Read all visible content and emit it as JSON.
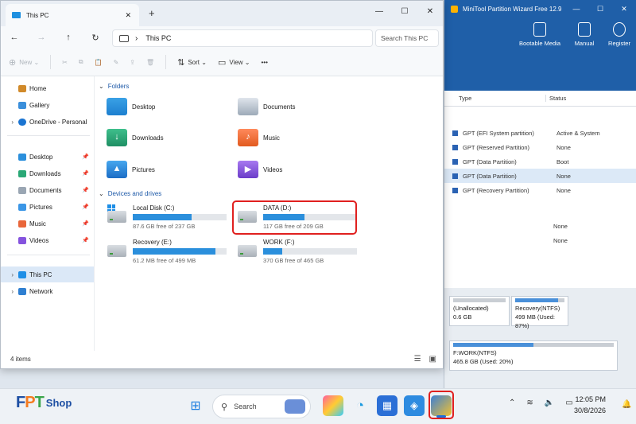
{
  "minitool": {
    "title": "MiniTool Partition Wizard Free 12.9",
    "title_controls": [
      "—",
      "☐",
      "✕"
    ],
    "tools": [
      {
        "label": "Bootable Media",
        "icon": "usb-icon"
      },
      {
        "label": "Manual",
        "icon": "book-icon"
      },
      {
        "label": "Register",
        "icon": "user-icon"
      }
    ],
    "columns": [
      "Type",
      "Status"
    ],
    "rows": [
      {
        "type": "GPT (EFI System partition)",
        "status": "Active & System"
      },
      {
        "type": "GPT (Reserved Partition)",
        "status": "None"
      },
      {
        "type": "GPT (Data Partition)",
        "status": "Boot"
      },
      {
        "type": "GPT (Data Partition)",
        "status": "None"
      },
      {
        "type": "GPT (Recovery Partition)",
        "status": "None"
      },
      {
        "type": "",
        "status": "None"
      },
      {
        "type": "",
        "status": "None"
      }
    ],
    "disk_parts": [
      {
        "name": "(Unallocated)",
        "size": "0.6 GB"
      },
      {
        "name": "Recovery(NTFS)",
        "size": "499 MB (Used: 87%)"
      },
      {
        "name": "F:WORK(NTFS)",
        "size": "465.8 GB (Used: 20%)"
      }
    ]
  },
  "explorer": {
    "tab_title": "This PC",
    "tab_close": "✕",
    "new_tab": "+",
    "window_controls": [
      "—",
      "☐",
      "✕"
    ],
    "nav": {
      "back": "←",
      "forward": "→",
      "up": "↑",
      "refresh": "↻"
    },
    "address": "This PC",
    "address_chevron": "›",
    "search_placeholder": "Search This PC",
    "commands": {
      "new": "New",
      "sort": "Sort",
      "view": "View",
      "more": "•••"
    },
    "sidebar": [
      {
        "label": "Home",
        "pinned": false
      },
      {
        "label": "Gallery",
        "pinned": false
      },
      {
        "label": "OneDrive - Personal",
        "pinned": false
      },
      {
        "label": "Desktop",
        "pinned": true
      },
      {
        "label": "Downloads",
        "pinned": true
      },
      {
        "label": "Documents",
        "pinned": true
      },
      {
        "label": "Pictures",
        "pinned": true
      },
      {
        "label": "Music",
        "pinned": true
      },
      {
        "label": "Videos",
        "pinned": true
      },
      {
        "label": "This PC",
        "pinned": false
      },
      {
        "label": "Network",
        "pinned": false
      }
    ],
    "groups": {
      "folders": "Folders",
      "drives": "Devices and drives"
    },
    "folders": [
      "Desktop",
      "Documents",
      "Downloads",
      "Music",
      "Pictures",
      "Videos"
    ],
    "drives": [
      {
        "name": "Local Disk (C:)",
        "free": "87.6 GB free of 237 GB",
        "used_fraction": 0.63
      },
      {
        "name": "DATA (D:)",
        "free": "117 GB free of 209 GB",
        "used_fraction": 0.44
      },
      {
        "name": "Recovery (E:)",
        "free": "61.2 MB free of 499 MB",
        "used_fraction": 0.88
      },
      {
        "name": "WORK (F:)",
        "free": "370 GB free of 465 GB",
        "used_fraction": 0.2
      }
    ],
    "status": "4 items"
  },
  "taskbar": {
    "brand": {
      "f": "F",
      "p": "P",
      "t": "T",
      "shop": "Shop"
    },
    "search_label": "Search",
    "time": "12:05 PM",
    "date": "30/8/2026"
  },
  "colors": {
    "accent": "#1f5fa8",
    "highlight": "#e0201f",
    "drive_bar": "#2b8fdc"
  }
}
